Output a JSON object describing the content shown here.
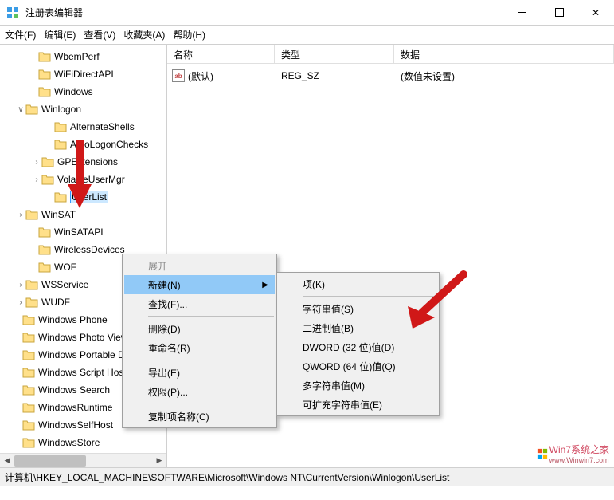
{
  "title": "注册表编辑器",
  "menu": {
    "file": "文件(F)",
    "edit": "编辑(E)",
    "view": "查看(V)",
    "fav": "收藏夹(A)",
    "help": "帮助(H)"
  },
  "tree": {
    "wbemperf": "WbemPerf",
    "wifidirect": "WiFiDirectAPI",
    "windows": "Windows",
    "winlogon": "Winlogon",
    "alternateshells": "AlternateShells",
    "autologon": "AutoLogonChecks",
    "gpextensions": "GPExtensions",
    "volatileuser": "VolatileUserMgr",
    "userlist": "UserList",
    "winsat": "WinSAT",
    "winsatapi": "WinSATAPI",
    "wirelessde": "WirelessDevices",
    "wof": "WOF",
    "wsservice": "WSService",
    "wudf": "WUDF",
    "winphone": "Windows Phone",
    "winphoto": "Windows Photo Viewer",
    "winportable": "Windows Portable Devices",
    "winscript": "Windows Script Host",
    "winsearch": "Windows Search",
    "winruntime": "WindowsRuntime",
    "winselfhost": "WindowsSelfHost",
    "winstore": "WindowsStore"
  },
  "list": {
    "headers": {
      "name": "名称",
      "type": "类型",
      "data": "数据"
    },
    "default_label": "(默认)",
    "default_type": "REG_SZ",
    "default_data": "(数值未设置)",
    "icon_text": "ab"
  },
  "ctx1": {
    "expand": "展开",
    "new": "新建(N)",
    "find": "查找(F)...",
    "delete": "删除(D)",
    "rename": "重命名(R)",
    "export": "导出(E)",
    "perm": "权限(P)...",
    "copykey": "复制项名称(C)"
  },
  "ctx2": {
    "key": "项(K)",
    "string": "字符串值(S)",
    "binary": "二进制值(B)",
    "dword": "DWORD (32 位)值(D)",
    "qword": "QWORD (64 位)值(Q)",
    "multi": "多字符串值(M)",
    "expand": "可扩充字符串值(E)"
  },
  "status": {
    "left": "计算机",
    "path": "HKEY_LOCAL_MACHINE\\SOFTWARE\\Microsoft\\Windows NT\\CurrentVersion\\Winlogon\\UserList"
  },
  "colors": {
    "accent": "#cce8ff",
    "hover": "#91c9f7",
    "arrow": "#d01818"
  },
  "watermark": {
    "text1": "Win7系统之家",
    "text2": "www.Winwin7.com"
  }
}
